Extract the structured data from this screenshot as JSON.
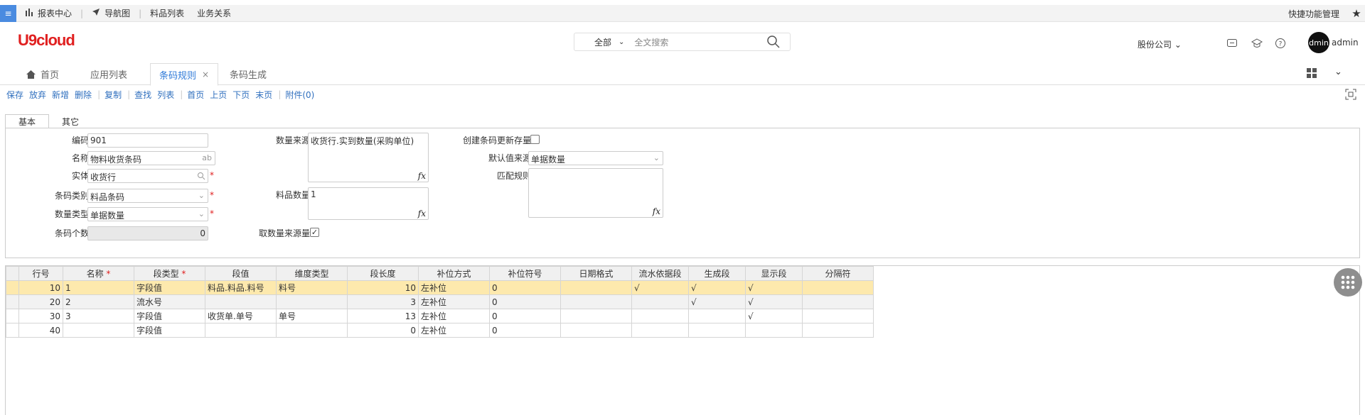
{
  "topbar": {
    "menu_icon": "≡",
    "links": [
      "报表中心",
      "导航图",
      "料品列表",
      "业务关系"
    ],
    "quick": "快捷功能管理"
  },
  "header": {
    "logo": "U9cloud",
    "search_scope": "全部",
    "search_placeholder": "全文搜索",
    "company": "股份公司",
    "avatar_text": "dmin",
    "user": "admin"
  },
  "tabs": [
    {
      "label": "首页"
    },
    {
      "label": "应用列表"
    },
    {
      "label": "条码规则"
    },
    {
      "label": "条码生成"
    }
  ],
  "toolbar": [
    "保存",
    "放弃",
    "新增",
    "删除",
    "复制",
    "查找",
    "列表",
    "首页",
    "上页",
    "下页",
    "末页",
    "附件(0)"
  ],
  "form_tabs": [
    "基本",
    "其它"
  ],
  "form": {
    "code_label": "编码",
    "code": "901",
    "name_label": "名称",
    "name": "物料收货条码",
    "name_suffix": "ab",
    "entity_label": "实体",
    "entity": "收货行",
    "barcode_type_label": "条码类别",
    "barcode_type": "料品条码",
    "qty_type_label": "数量类型",
    "qty_type": "单据数量",
    "barcode_count_label": "条码个数",
    "barcode_count": "0",
    "qty_source_label": "数量来源",
    "qty_source": "收货行.实到数量(采购单位)",
    "item_qty_label": "料品数量",
    "item_qty": "1",
    "take_qty_label": "取数量来源量",
    "update_stock_label": "创建条码更新存量",
    "default_src_label": "默认值来源",
    "default_src": "单据数量",
    "match_rule_label": "匹配规则",
    "required_mark": "*"
  },
  "grid": {
    "columns": [
      "行号",
      "名称",
      "段类型",
      "段值",
      "维度类型",
      "段长度",
      "补位方式",
      "补位符号",
      "日期格式",
      "流水依据段",
      "生成段",
      "显示段",
      "分隔符"
    ],
    "required_mark": "*",
    "rows": [
      [
        "10",
        "1",
        "字段值",
        "料品.料品.料号",
        "料号",
        "10",
        "左补位",
        "0",
        "",
        "√",
        "√",
        "√",
        ""
      ],
      [
        "20",
        "2",
        "流水号",
        "",
        "",
        "3",
        "左补位",
        "0",
        "",
        "",
        "√",
        "√",
        ""
      ],
      [
        "30",
        "3",
        "字段值",
        "收货单.单号",
        "单号",
        "13",
        "左补位",
        "0",
        "",
        "",
        "",
        "√",
        ""
      ],
      [
        "40",
        "",
        "字段值",
        "",
        "",
        "0",
        "左补位",
        "0",
        "",
        "",
        "",
        "",
        ""
      ]
    ]
  },
  "colors": {
    "accent": "#2f7ad8",
    "brand": "#e02020",
    "selected_row": "#fde9ad"
  }
}
